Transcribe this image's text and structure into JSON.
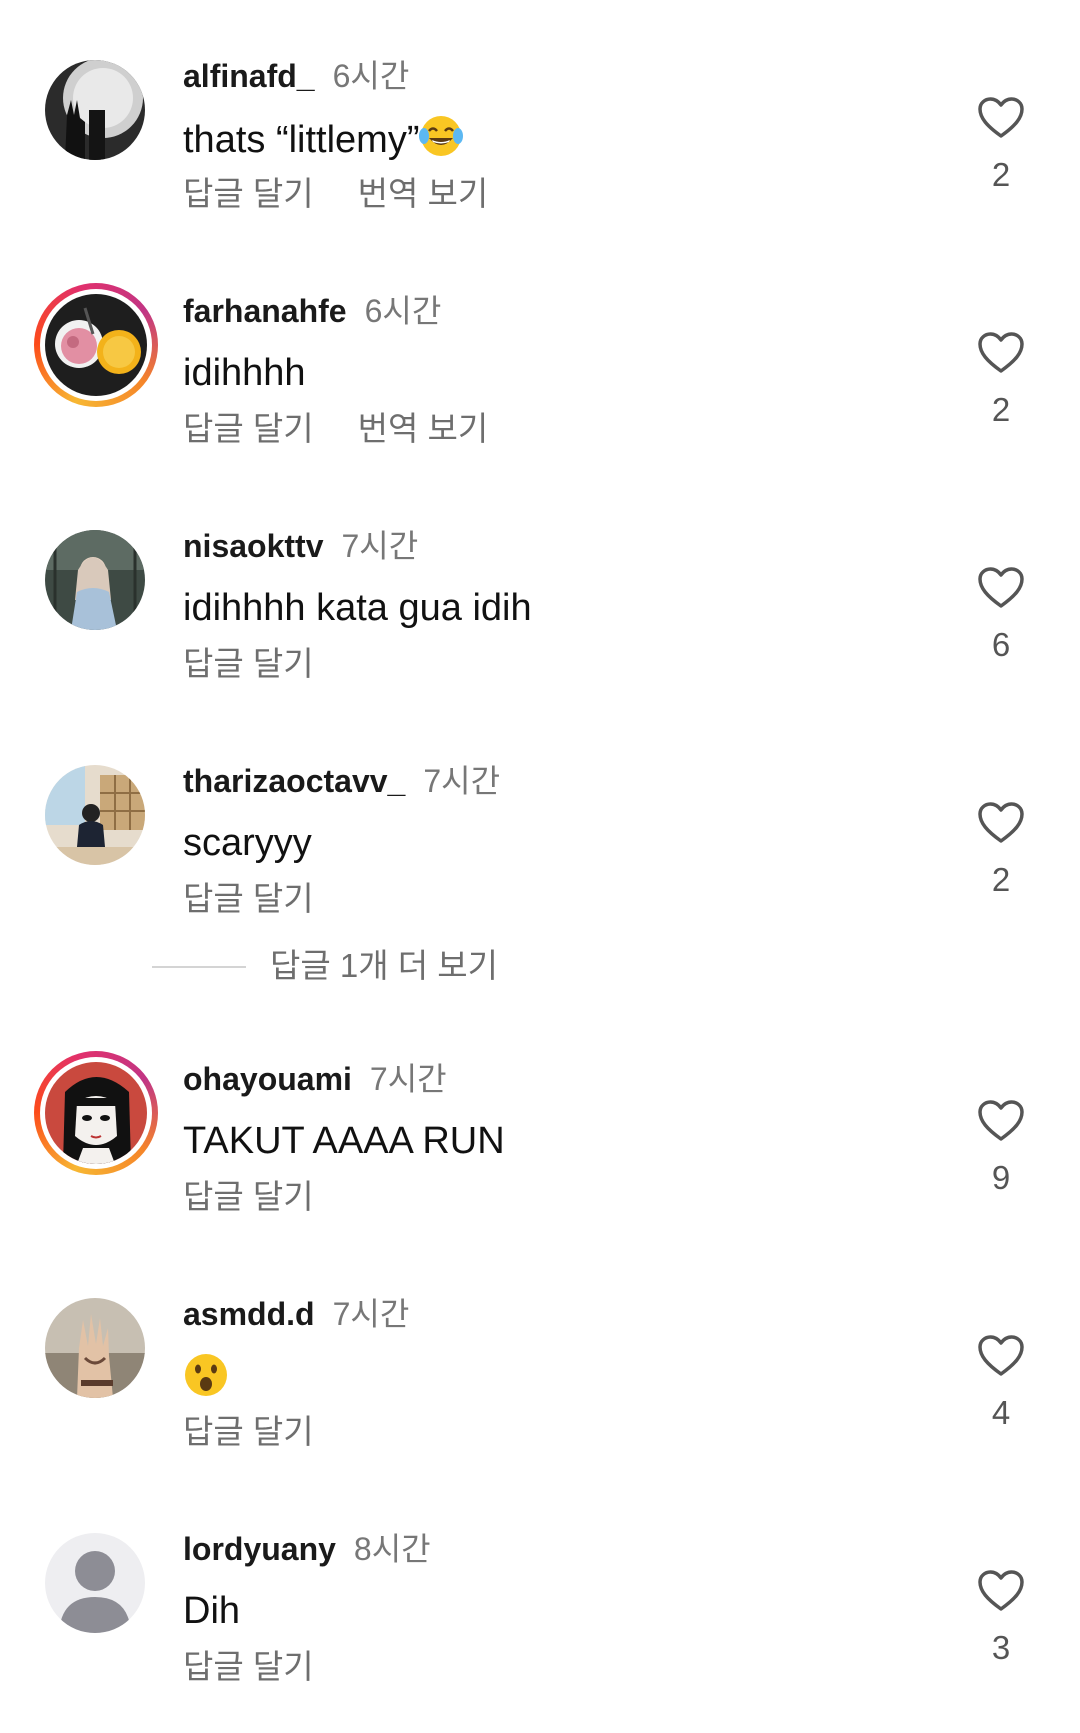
{
  "comments": [
    {
      "username": "alfinafd_",
      "time": "6시간",
      "text": "thats “littlemy”",
      "emoji": "laughing-tears",
      "reply_label": "답글 달기",
      "translate_label": "번역 보기",
      "likes": "2",
      "story_ring": false
    },
    {
      "username": "farhanahfe",
      "time": "6시간",
      "text": "idihhhh",
      "reply_label": "답글 달기",
      "translate_label": "번역 보기",
      "likes": "2",
      "story_ring": true
    },
    {
      "username": "nisaokttv",
      "time": "7시간",
      "text": "idihhhh kata gua idih",
      "reply_label": "답글 달기",
      "likes": "6",
      "story_ring": false
    },
    {
      "username": "tharizaoctavv_",
      "time": "7시간",
      "text": "scaryyy",
      "reply_label": "답글 달기",
      "likes": "2",
      "story_ring": false
    },
    {
      "username": "ohayouami",
      "time": "7시간",
      "text": "TAKUT AAAA RUN",
      "reply_label": "답글 달기",
      "likes": "9",
      "story_ring": true
    },
    {
      "username": "asmdd.d",
      "time": "7시간",
      "text": "",
      "emoji": "surprised-face",
      "reply_label": "답글 달기",
      "likes": "4",
      "story_ring": false
    },
    {
      "username": "lordyuany",
      "time": "8시간",
      "text": "Dih",
      "reply_label": "답글 달기",
      "likes": "3",
      "story_ring": false
    }
  ],
  "more_replies": {
    "label": "답글 1개 더 보기"
  },
  "colors": {
    "text": "#111111",
    "muted": "#6e6e6e",
    "line": "#d4d4d4"
  }
}
